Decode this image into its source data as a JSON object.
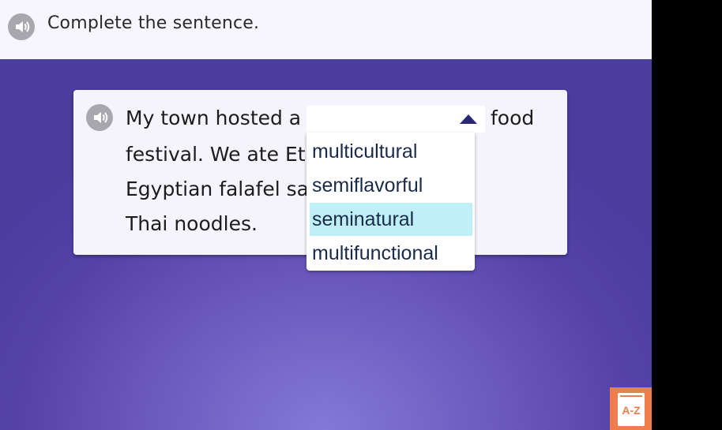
{
  "header": {
    "prompt": "Complete the sentence.",
    "speaker_icon": "speaker-icon"
  },
  "card": {
    "speaker_icon": "speaker-icon",
    "lines": [
      "My town hosted a",
      "festival. We ate Ethiopian bread,",
      "Egyptian falafel salad, and spicy",
      "Thai noodles."
    ],
    "line1_tail": "food"
  },
  "dropdown": {
    "selected": "",
    "options": [
      "multicultural",
      "semiflavorful",
      "seminatural",
      "multifunctional"
    ],
    "highlighted_index": 2,
    "arrow_icon": "caret-up-icon"
  },
  "az_button": {
    "label": "A-Z",
    "icon": "book-icon"
  },
  "colors": {
    "highlight": "#bff0f8",
    "az_orange": "#f07d4e"
  }
}
